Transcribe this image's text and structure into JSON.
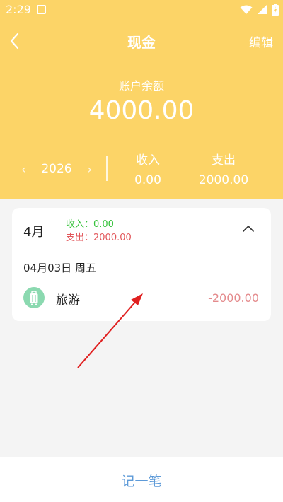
{
  "status": {
    "time": "2:29"
  },
  "nav": {
    "title": "现金",
    "edit_label": "编辑"
  },
  "balance": {
    "label": "账户余额",
    "value": "4000.00"
  },
  "year_switch": {
    "prev": "‹",
    "year": "2026",
    "next": "›"
  },
  "summary": {
    "income_label": "收入",
    "income_value": "0.00",
    "expense_label": "支出",
    "expense_value": "2000.00"
  },
  "month_card": {
    "month": "4月",
    "income_text": "收入：0.00",
    "expense_text": "支出：2000.00",
    "day_header": "04月03日 周五",
    "record": {
      "category": "旅游",
      "amount": "-2000.00",
      "icon": "luggage-icon"
    }
  },
  "bottom": {
    "record_label": "记一笔"
  },
  "colors": {
    "header_bg": "#fcd467",
    "income_green": "#36c23b",
    "expense_red": "#e2575b",
    "amount_red": "#e48a8c",
    "category_icon_bg": "#8bd9b0",
    "button_blue": "#5d9ad8",
    "annotation_arrow": "#e02020"
  }
}
